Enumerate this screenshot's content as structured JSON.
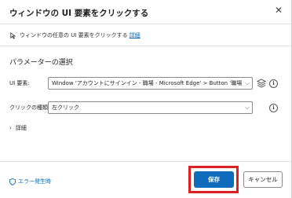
{
  "dialog": {
    "title": "ウィンドウの UI 要素をクリックする",
    "description": "ウィンドウの任意の UI 要素をクリックする",
    "description_link": "詳細"
  },
  "parameters": {
    "section_title": "パラメーターの選択",
    "ui_element_label": "UI 要素:",
    "ui_element_value": "Window 'アカウントにサインイン - 職場 - Microsoft Edge' > Button '職場または",
    "click_type_label": "クリックの種類:",
    "click_type_value": "左クリック",
    "details_label": "詳細"
  },
  "footer": {
    "error_label": "エラー発生時",
    "save_label": "保存",
    "cancel_label": "キャンセル"
  },
  "colors": {
    "accent": "#0f6cbd",
    "highlight": "#e02020"
  },
  "icons": [
    "close-icon",
    "pointer-icon",
    "chevron-down-icon",
    "layers-icon",
    "info-icon",
    "chevron-right-icon",
    "shield-icon"
  ]
}
